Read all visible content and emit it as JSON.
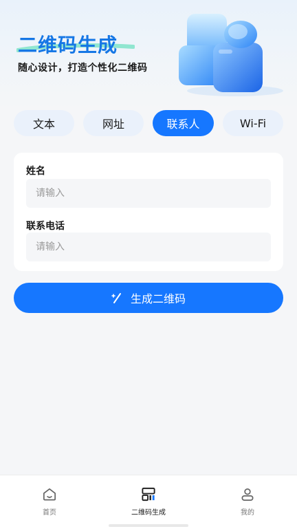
{
  "hero": {
    "title": "二维码生成",
    "subtitle": "随心设计，打造个性化二维码"
  },
  "tabs": [
    {
      "label": "文本",
      "active": false
    },
    {
      "label": "网址",
      "active": false
    },
    {
      "label": "联系人",
      "active": true
    },
    {
      "label": "Wi-Fi",
      "active": false
    }
  ],
  "form": {
    "name_label": "姓名",
    "name_placeholder": "请输入",
    "phone_label": "联系电话",
    "phone_placeholder": "请输入"
  },
  "generate_button": {
    "label": "生成二维码",
    "icon": "magic-wand-icon"
  },
  "tabbar": [
    {
      "label": "首页",
      "icon": "home-icon",
      "active": false
    },
    {
      "label": "二维码生成",
      "icon": "qrcode-generate-icon",
      "active": true
    },
    {
      "label": "我的",
      "icon": "user-icon",
      "active": false
    }
  ],
  "colors": {
    "accent": "#1677ff",
    "tab_bg": "#eaf1fb",
    "page_bg": "#f5f6f8"
  }
}
